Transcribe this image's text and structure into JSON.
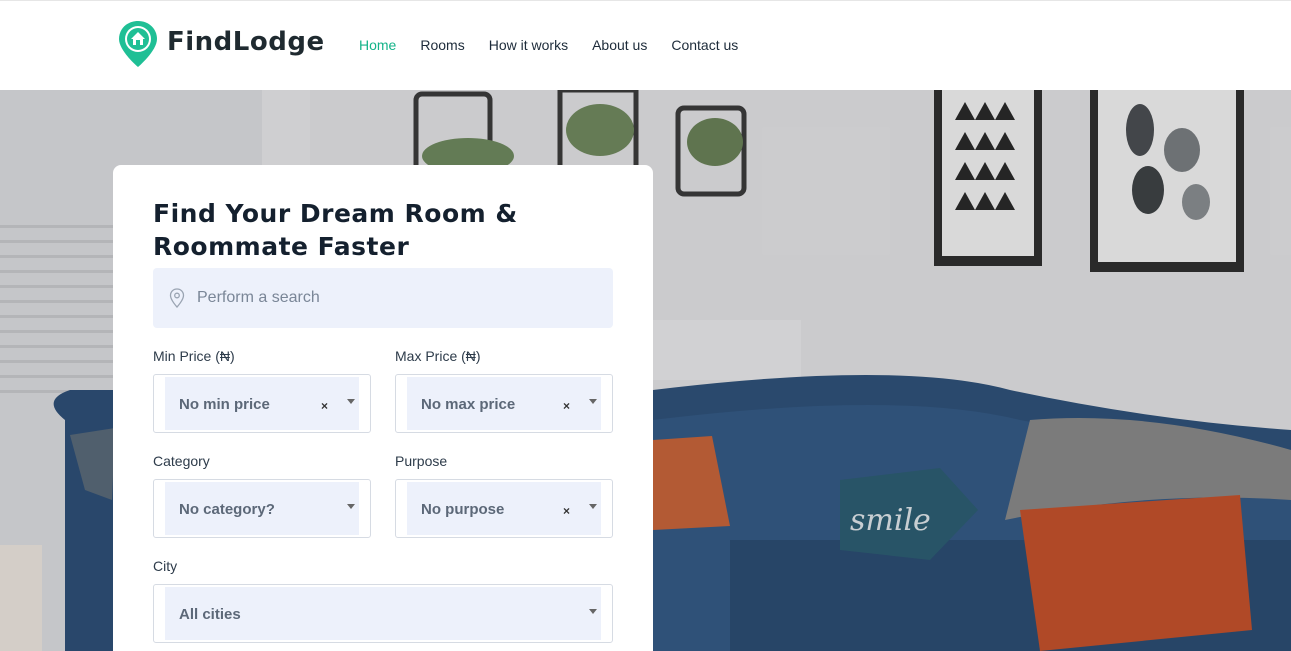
{
  "brand": {
    "name": "FindLodge",
    "accent": "#14b389"
  },
  "nav": [
    {
      "label": "Home",
      "active": true
    },
    {
      "label": "Rooms"
    },
    {
      "label": "How it works"
    },
    {
      "label": "About us"
    },
    {
      "label": "Contact us"
    }
  ],
  "search_card": {
    "title": "Find Your Dream Room & Roommate Faster",
    "search_placeholder": "Perform a search",
    "min_price": {
      "label": "Min Price (₦)",
      "value": "No min price"
    },
    "max_price": {
      "label": "Max Price (₦)",
      "value": "No max price"
    },
    "category": {
      "label": "Category",
      "value": "No category?"
    },
    "purpose": {
      "label": "Purpose",
      "value": "No purpose"
    },
    "city": {
      "label": "City",
      "value": "All cities"
    },
    "clear_glyph": "×"
  }
}
